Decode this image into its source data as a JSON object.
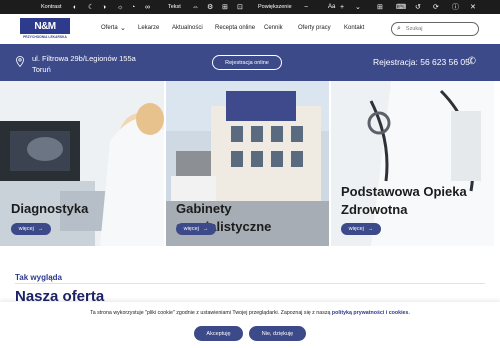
{
  "a11y_bar": {
    "contrast_label": "Kontrast",
    "text_label": "Tekst",
    "zoom_label": "Powiększenie",
    "font_label": "Aa"
  },
  "header": {
    "logo_mark": "N&M",
    "logo_sub": "PRZYCHODNIA LEKARSKA",
    "nav": [
      "Oferta",
      "Lekarze",
      "Aktualności",
      "Recepta online",
      "Cennik",
      "Oferty pracy",
      "Kontakt"
    ],
    "search_placeholder": "Szukaj"
  },
  "info_bar": {
    "address_line1": "ul. Filtrowa 29b/Legionów 155a",
    "address_line2": "Toruń",
    "register_button": "Rejestracja online",
    "phone": "Rejestracja: 56 623 56 05"
  },
  "cards": [
    {
      "title": "Diagnostyka",
      "more": "więcej"
    },
    {
      "title": "Gabinety specjalistyczne",
      "more": "więcej"
    },
    {
      "title_line1": "Podstawowa Opieka",
      "title_line2": "Zdrowotna",
      "more": "więcej"
    }
  ],
  "section": {
    "kicker": "Tak wygląda",
    "title": "Nasza oferta"
  },
  "cookie": {
    "text_before": "Ta strona wykorzystuje \"pliki cookie\" zgodnie z ustawieniami Twojej przeglądarki. Zapoznaj się z naszą ",
    "link": "polityką prywatności i cookies",
    "text_after": ".",
    "accept": "Akceptuję",
    "decline": "Nie, dziękuję"
  },
  "colors": {
    "brand_blue": "#3d4a8a",
    "dark_bar": "#1c1c1c"
  }
}
